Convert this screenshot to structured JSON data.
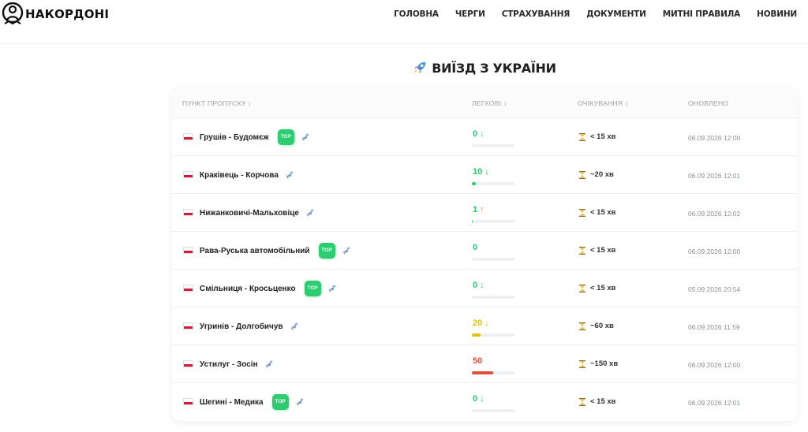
{
  "header": {
    "logo_text": "НАКОРДОНІ",
    "nav": [
      "ГОЛОВНА",
      "ЧЕРГИ",
      "СТРАХУВАННЯ",
      "ДОКУМЕНТИ",
      "МИТНІ ПРАВИЛА",
      "НОВИНИ"
    ]
  },
  "page_title": "ВИЇЗД З УКРАЇНИ",
  "table": {
    "columns": {
      "point": "ПУНКТ ПРОПУСКУ ↕",
      "cars": "ЛЕГКОВІ ↕",
      "wait": "ОЧІКУВАННЯ ↕",
      "updated": "ОНОВЛЕНО"
    },
    "rows": [
      {
        "name": "Грушів - Будомєж",
        "top": "TOP",
        "cars": "0",
        "arrow": "↓",
        "trend": "down",
        "level": 0.0,
        "wait": "< 15 хв",
        "updated": "06.09.2026 12:00"
      },
      {
        "name": "Краківець - Корчова",
        "top": "",
        "cars": "10",
        "arrow": "↓",
        "trend": "down",
        "level": 0.1,
        "wait": "~20 хв",
        "updated": "06.09.2026 12:01"
      },
      {
        "name": "Нижанковичі-Мальховіце",
        "top": "",
        "cars": "1",
        "arrow": "↑",
        "trend": "up",
        "level": 0.02,
        "wait": "< 15 хв",
        "updated": "06.09.2026 12:02"
      },
      {
        "name": "Рава-Руська автомобільний",
        "top": "TOP",
        "cars": "0",
        "arrow": "",
        "trend": "flat",
        "level": 0.0,
        "wait": "< 15 хв",
        "updated": "06.09.2026 12:00"
      },
      {
        "name": "Смільниця - Кросьценко",
        "top": "TOP",
        "cars": "0",
        "arrow": "↓",
        "trend": "down",
        "level": 0.0,
        "wait": "< 15 хв",
        "updated": "05.09.2026 20:54"
      },
      {
        "name": "Угринів - Долгобичув",
        "top": "",
        "cars": "20",
        "arrow": "↓",
        "trend": "down-yellow",
        "level": 0.2,
        "wait": "~60 хв",
        "updated": "06.09.2026 11:59"
      },
      {
        "name": "Устилуг - Зосін",
        "top": "",
        "cars": "50",
        "arrow": "",
        "trend": "high",
        "level": 0.5,
        "wait": "~150 хв",
        "updated": "06.09.2026 12:00"
      },
      {
        "name": "Шегині - Медика",
        "top": "TOP",
        "cars": "0",
        "arrow": "↓",
        "trend": "down",
        "level": 0.0,
        "wait": "< 15 хв",
        "updated": "06.09.2026 12:01"
      }
    ]
  },
  "colors": {
    "green": "#2ecc71",
    "yellow": "#e1c211",
    "red": "#e0513d",
    "up_red": "#f08b74"
  }
}
